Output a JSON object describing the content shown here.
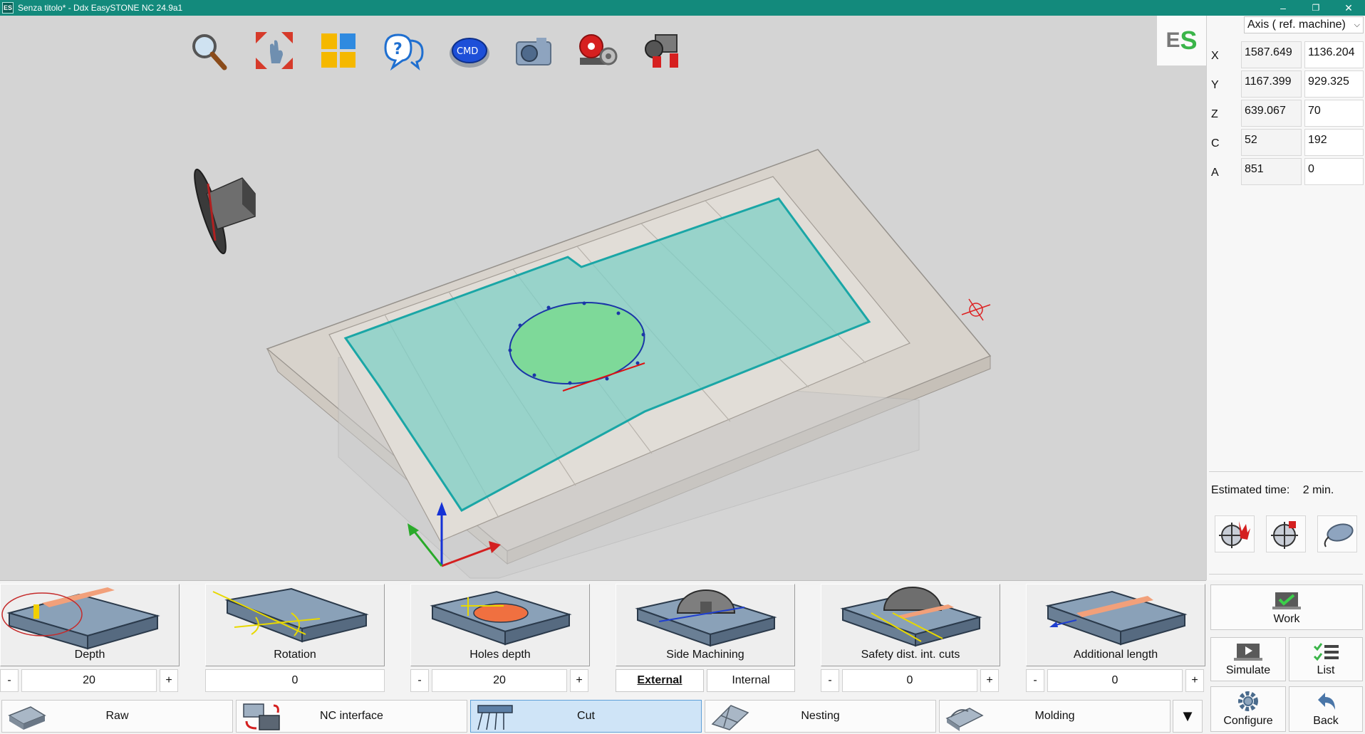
{
  "window": {
    "icon_text": "ES",
    "title": "Senza titolo* - Ddx EasySTONE NC 24.9a1",
    "controls": {
      "minimize": "–",
      "maximize": "❐",
      "close": "✕"
    }
  },
  "logo": {
    "e": "E",
    "s": "S"
  },
  "toolbar": [
    {
      "icon": "magnifier-icon"
    },
    {
      "icon": "zoom-extents-icon"
    },
    {
      "icon": "views-grid-icon"
    },
    {
      "icon": "help-chat-icon"
    },
    {
      "icon": "cmd-button-icon"
    },
    {
      "icon": "camera-icon"
    },
    {
      "icon": "machine-settings-icon"
    },
    {
      "icon": "machine-icon"
    }
  ],
  "axis_panel": {
    "mode": "Axis ( ref. machine)",
    "rows": [
      {
        "label": "X",
        "current": "1587.649",
        "target": "1136.204"
      },
      {
        "label": "Y",
        "current": "1167.399",
        "target": "929.325"
      },
      {
        "label": "Z",
        "current": "639.067",
        "target": "70"
      },
      {
        "label": "C",
        "current": "52",
        "target": "192"
      },
      {
        "label": "A",
        "current": "851",
        "target": "0"
      }
    ],
    "estimated_time_label": "Estimated time:",
    "estimated_time_value": "2 min."
  },
  "operations": {
    "depth": {
      "label": "Depth",
      "value": "20",
      "minus": "-",
      "plus": "+"
    },
    "rotation": {
      "label": "Rotation",
      "value": "0"
    },
    "holes_depth": {
      "label": "Holes depth",
      "value": "20",
      "minus": "-",
      "plus": "+"
    },
    "side_machining": {
      "label": "Side Machining",
      "option_external": "External",
      "option_internal": "Internal"
    },
    "safety_dist": {
      "label": "Safety dist. int. cuts",
      "value": "0",
      "minus": "-",
      "plus": "+"
    },
    "additional_length": {
      "label": "Additional length",
      "value": "0",
      "minus": "-",
      "plus": "+"
    }
  },
  "tabs": [
    {
      "label": "Raw"
    },
    {
      "label": "NC interface"
    },
    {
      "label": "Cut"
    },
    {
      "label": "Nesting"
    },
    {
      "label": "Molding"
    }
  ],
  "tab_more": "▼",
  "actions": {
    "work": "Work",
    "simulate": "Simulate",
    "list": "List",
    "configure": "Configure",
    "back": "Back"
  },
  "colors": {
    "titlebar": "#138a7c",
    "viewport_bg": "#d4d4d4",
    "slab_fill": "#7fcfc6",
    "slab_edge": "#1aa6a6",
    "hole_fill": "#7ed999",
    "active_tab": "#cfe4f7"
  }
}
